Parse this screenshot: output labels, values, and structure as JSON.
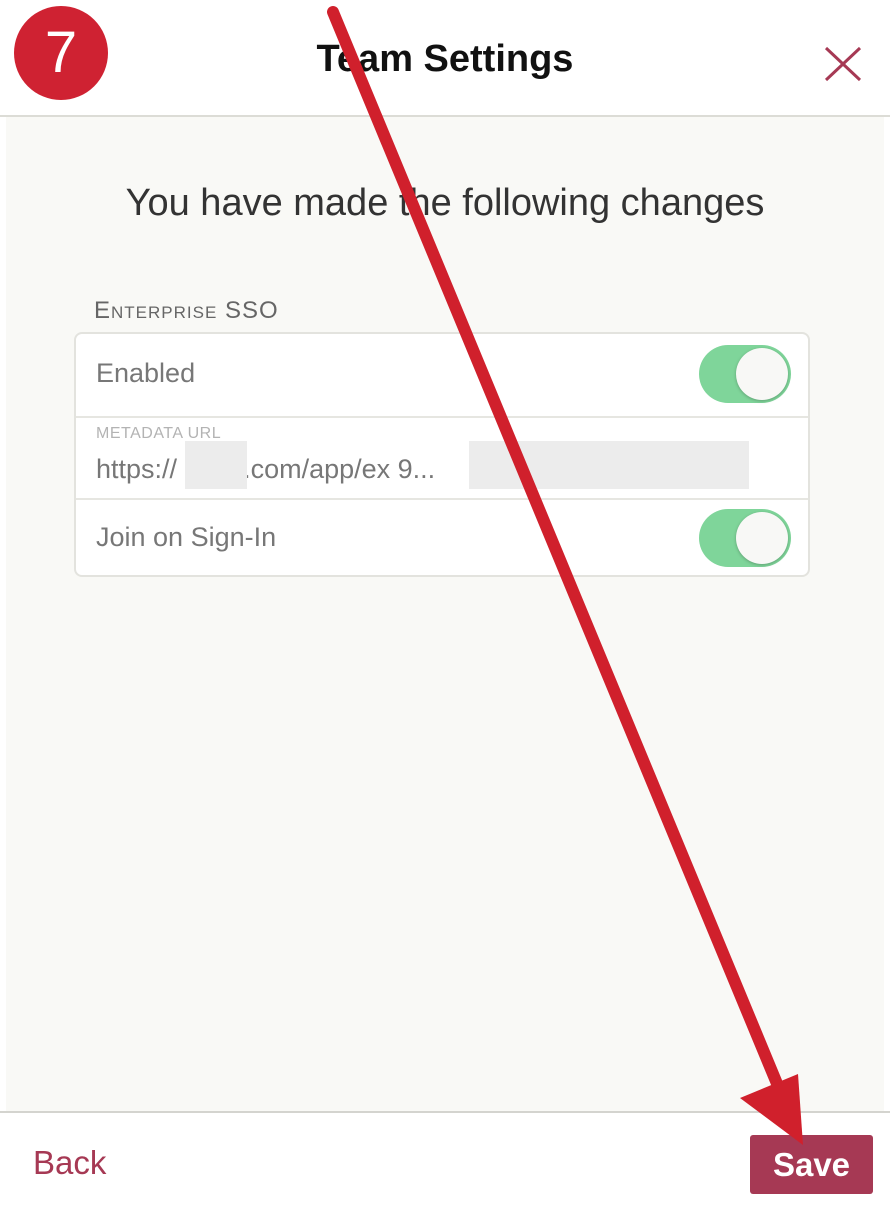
{
  "step_badge": "7",
  "header": {
    "title": "Team Settings",
    "close_icon": "close-icon"
  },
  "main": {
    "heading": "You have made the following changes",
    "section_label": "Enterprise SSO",
    "rows": {
      "enabled": {
        "label": "Enabled",
        "toggle_on": true
      },
      "metadata": {
        "caption": "METADATA URL",
        "value": "https://        .okta.com/app/ex                                              9..."
      },
      "join": {
        "label": "Join on Sign-In",
        "toggle_on": true
      }
    }
  },
  "footer": {
    "back_label": "Back",
    "save_label": "Save"
  },
  "colors": {
    "accent": "#a63954",
    "badge": "#cf2232",
    "toggle_on": "#7fd59a",
    "arrow": "#d0202c"
  }
}
